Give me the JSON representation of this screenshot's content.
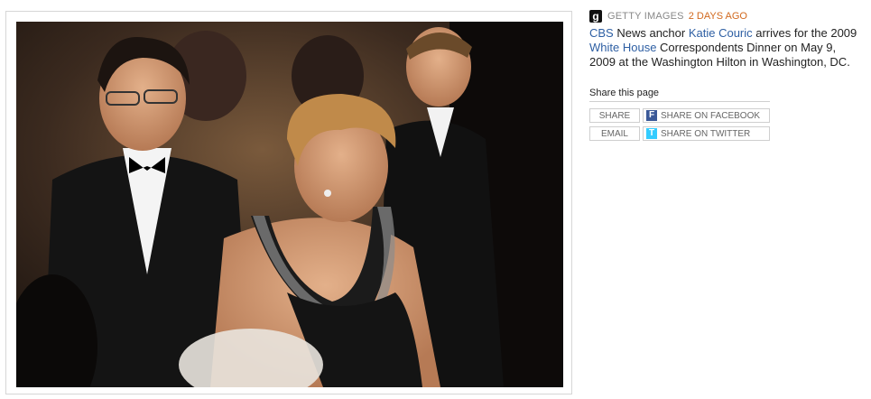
{
  "photo": {
    "alt": "CBS News anchor Katie Couric at the White House Correspondents Dinner"
  },
  "source": {
    "logo_letter": "g",
    "name": "GETTY IMAGES",
    "age": "2 DAYS AGO"
  },
  "caption": {
    "link_cbs": "CBS",
    "text_1": " News anchor ",
    "link_katie": "Katie Couric",
    "text_2": " arrives for the 2009 ",
    "link_white_house": "White House",
    "text_3": " Correspondents Dinner on May 9, 2009 at the Washington Hilton in Washington, DC."
  },
  "share": {
    "heading": "Share this page",
    "share_label": "SHARE",
    "email_label": "EMAIL",
    "facebook_label": "SHARE ON FACEBOOK",
    "twitter_label": "SHARE ON TWITTER",
    "facebook_icon": "facebook-icon",
    "twitter_icon": "twitter-icon"
  },
  "colors": {
    "link": "#2e5fa3",
    "age": "#d2691e",
    "facebook": "#3b5998",
    "twitter": "#33ccff"
  }
}
